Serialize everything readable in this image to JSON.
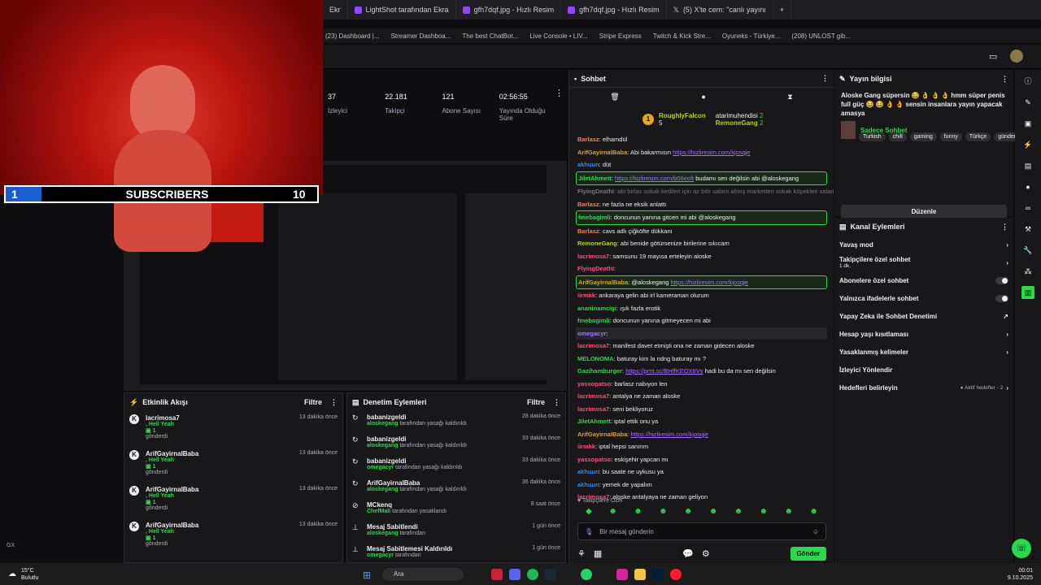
{
  "browser_tabs": [
    "Ekr",
    "LightShot tarafından Ekra",
    "gfh7dqf.jpg - Hızlı Resim",
    "gfh7dqf.jpg - Hızlı Resim",
    "(5) X'te cem: \"canlı yayını"
  ],
  "bookmarks": [
    "(23) Dashboard |...",
    "Streamer Dashboa...",
    "The best ChatBot...",
    "Live Console • LIV...",
    "Stripe Express",
    "Twitch & Kick Stre...",
    "Oyuneks - Türkiye...",
    "(208) UNLOST gib..."
  ],
  "overlay": {
    "sub_count": "1",
    "label": "SUBSCRIBERS",
    "goal": "10"
  },
  "stats": [
    {
      "value": "37",
      "label": "İzleyici"
    },
    {
      "value": "22.181",
      "label": "Takipçi"
    },
    {
      "value": "121",
      "label": "Abone Sayısı"
    },
    {
      "value": "02:56:55",
      "label": "Yayında Olduğu Süre"
    }
  ],
  "activity": {
    "title": "Etkinlik Akışı",
    "filter": "Filtre",
    "items": [
      {
        "name": "lacrimosa7",
        "detail": "Hell Yeah",
        "sub": "1",
        "action": "gönderdi",
        "time": "13 dakika önce"
      },
      {
        "name": "ArifGayirnalBaba",
        "detail": "Hell Yeah",
        "sub": "1",
        "action": "gönderdi",
        "time": "13 dakika önce"
      },
      {
        "name": "ArifGayirnalBaba",
        "detail": "Hell Yeah",
        "sub": "1",
        "action": "gönderdi",
        "time": "13 dakika önce"
      },
      {
        "name": "ArifGayirnalBaba",
        "detail": "Hell Yeah",
        "sub": "1",
        "action": "gönderdi",
        "time": "13 dakika önce"
      }
    ]
  },
  "modlog": {
    "title": "Denetim Eylemleri",
    "filter": "Filtre",
    "items": [
      {
        "icon": "↻",
        "name": "babanizgeldi",
        "by": "aloskegang",
        "text": "tarafından yasağı kaldırıldı",
        "time": "28 dakika önce"
      },
      {
        "icon": "↻",
        "name": "babanizgeldi",
        "by": "aloskegang",
        "text": "tarafından yasağı kaldırıldı",
        "time": "33 dakika önce"
      },
      {
        "icon": "↻",
        "name": "babanizgeldi",
        "by": "omegacyr",
        "text": "tarafından yasağı kaldırıldı",
        "time": "33 dakika önce"
      },
      {
        "icon": "↻",
        "name": "ArifGayirnalBaba",
        "by": "aloskegang",
        "text": "tarafından yasağı kaldırıldı",
        "time": "36 dakika önce"
      },
      {
        "icon": "⊘",
        "name": "MCkenq",
        "by": "ChefMali",
        "text": "tarafından yasaklandı",
        "time": "8 saat önce"
      },
      {
        "icon": "⊥",
        "name": "Mesaj Sabitlendi",
        "by": "aloskegang",
        "text": "tarafından",
        "time": "1 gün önce"
      },
      {
        "icon": "⊥",
        "name": "Mesaj Sabitlemesi Kaldırıldı",
        "by": "omegacyr",
        "text": "tarafından",
        "time": "1 gün önce"
      }
    ]
  },
  "chat": {
    "title": "Sohbet",
    "leaders": [
      {
        "rank": "1",
        "name": "RoughlyFalcon",
        "score": "5"
      },
      {
        "name": "atarimuhendisi",
        "score": "2"
      },
      {
        "name": "RemoneGang",
        "score": "2"
      }
    ],
    "messages": [
      {
        "u": "Barlasz",
        "c": "#ff7f50",
        "t": ": elhamdül",
        "s": ""
      },
      {
        "u": "ArifGayirnalBaba",
        "c": "#daa520",
        "t": ": Abi bakarmısın ",
        "l": "https://hizliresim.com/kjosqje",
        "s": ""
      },
      {
        "u": "akhuun",
        "c": "#1e90ff",
        "t": ": düt",
        "s": ""
      },
      {
        "u": "JiletAhmett",
        "c": "#2bd94c",
        "t": ": ",
        "l": "https://hizliresim.com/b06eoft",
        "t2": " budamı sen değilsin abi @aloskegang",
        "s": "hl"
      },
      {
        "u": "FlyingDeathI",
        "c": "#777",
        "t": ": abi birlas sokak kedileri için az bitir salam almış marketten sokak köpekleri salami gesp...",
        "s": "dim"
      },
      {
        "u": "Barlasz",
        "c": "#ff7f50",
        "t": ": ne fazla ne eksik anlattı",
        "s": ""
      },
      {
        "u": "fmebagimli",
        "c": "#2bd94c",
        "t": ": doncunun yanına gitcen mi abi @aloskegang",
        "s": "hl"
      },
      {
        "u": "Barlasz",
        "c": "#ff7f50",
        "t": ": cavs adlı çiğköfte dükkanı",
        "s": ""
      },
      {
        "u": "RemoneGang",
        "c": "#b8d40b",
        "t": ": abi benide götürsenize birilerine sıkıcam",
        "s": ""
      },
      {
        "u": "lacrimosa7",
        "c": "#ff4f7a",
        "t": ": samsunu 19 mayısa erteleyin aloske",
        "s": ""
      },
      {
        "u": "FlyingDeathI",
        "c": "#ff4f7a",
        "t": ": ",
        "s": ""
      },
      {
        "u": "ArifGayirnalBaba",
        "c": "#daa520",
        "t": ": @aloskegang ",
        "l": "https://hizliresim.com/kjosqje",
        "s": "hl"
      },
      {
        "u": "iirmkk",
        "c": "#ff4f7a",
        "t": ": ankaraya gelin abi irl  kameraman olurum",
        "s": ""
      },
      {
        "u": "ananinamcigi",
        "c": "#2bd94c",
        "t": ": ışık fazla erotik",
        "s": ""
      },
      {
        "u": "fmebagimli",
        "c": "#2bd94c",
        "t": ": doncunun yanına gitmeyecen mi abi",
        "s": ""
      },
      {
        "u": "omegacyr",
        "c": "#a970ff",
        "t": ": ",
        "s": "hl2"
      },
      {
        "u": "lacrimosa7",
        "c": "#ff4f7a",
        "t": ": manifest davet etmişti ona ne zaman gidecen aloske",
        "s": ""
      },
      {
        "u": "MELONOMA",
        "c": "#2bd94c",
        "t": ": baturay kim la ndng baturay mı ?",
        "s": ""
      },
      {
        "u": "Gazihamburger",
        "c": "#2bd94c",
        "t": ": ",
        "l": "https://prnt.sc/BHffKEOXtIVs",
        "t2": " hadi bu da mı sen değilsin",
        "s": ""
      },
      {
        "u": "yassopatso",
        "c": "#ff4f7a",
        "t": ": barlasz nabıyon len",
        "s": ""
      },
      {
        "u": "lacrimosa7",
        "c": "#ff4f7a",
        "t": ": antalya ne zaman aloske",
        "s": ""
      },
      {
        "u": "lacrimosa7",
        "c": "#ff4f7a",
        "t": ": seni bekliyoruz",
        "s": ""
      },
      {
        "u": "JiletAhmett",
        "c": "#2bd94c",
        "t": ": iptal ettik onu ya",
        "s": ""
      },
      {
        "u": "ArifGayirnalBaba",
        "c": "#daa520",
        "t": ": ",
        "l": "https://hizliresim.com/kjosqje",
        "s": ""
      },
      {
        "u": "iirmkk",
        "c": "#ff4f7a",
        "t": ": iptal hepsi sanırım",
        "s": ""
      },
      {
        "u": "yassopatso",
        "c": "#ff4f7a",
        "t": ": eskişehir yapcan mı",
        "s": ""
      },
      {
        "u": "akhuun",
        "c": "#1e90ff",
        "t": ": bu saate ne uykusu ya",
        "s": ""
      },
      {
        "u": "akhuun",
        "c": "#1e90ff",
        "t": ": yemek de yapalım",
        "s": ""
      },
      {
        "u": "lacrimosa7",
        "c": "#ff4f7a",
        "t": ": aloske antalyaya ne zaman geliyon",
        "s": ""
      }
    ],
    "followers_only": "Takipçilere Özel",
    "input_placeholder": "Bir mesaj gönderin",
    "send": "Gönder"
  },
  "stream_info": {
    "title": "Yayın bilgisi",
    "stream_title": "Aloske Gang süpersin 😂 👌 👌 👌 hmm süper penis full güç 😂 😂 👌 👌 sensin insanlara yayın yapacak amasya",
    "category": "Sadece Sohbet",
    "tags": [
      "Turkish",
      "chill",
      "gaming",
      "funny",
      "Türkçe",
      "gündem"
    ],
    "edit": "Düzenle"
  },
  "channel_actions": {
    "title": "Kanal Eylemleri",
    "items": [
      {
        "label": "Yavaş mod",
        "kind": "arrow",
        "sub": ""
      },
      {
        "label": "Takipçilere özel sohbet",
        "kind": "arrow",
        "sub": "1 dk."
      },
      {
        "label": "Abonelere özel sohbet",
        "kind": "toggle",
        "sub": ""
      },
      {
        "label": "Yalnızca ifadelerle sohbet",
        "kind": "toggle",
        "sub": ""
      },
      {
        "label": "Yapay Zeka ile Sohbet Denetimi",
        "kind": "ext",
        "sub": ""
      },
      {
        "label": "Hesap yaşı kısıtlaması",
        "kind": "arrow",
        "sub": ""
      },
      {
        "label": "Yasaklanmış kelimeler",
        "kind": "arrow",
        "sub": ""
      },
      {
        "label": "İzleyici Yönlendir",
        "kind": "none",
        "sub": ""
      },
      {
        "label": "Hedefleri belirleyin",
        "kind": "arrow",
        "sub": "● Aktif hedefler - 2"
      }
    ]
  },
  "taskbar": {
    "weather_temp": "15°C",
    "weather_desc": "Bulutlu",
    "search": "Ara",
    "time": "00:01",
    "date": "9.10.2025"
  },
  "gx": "GX"
}
